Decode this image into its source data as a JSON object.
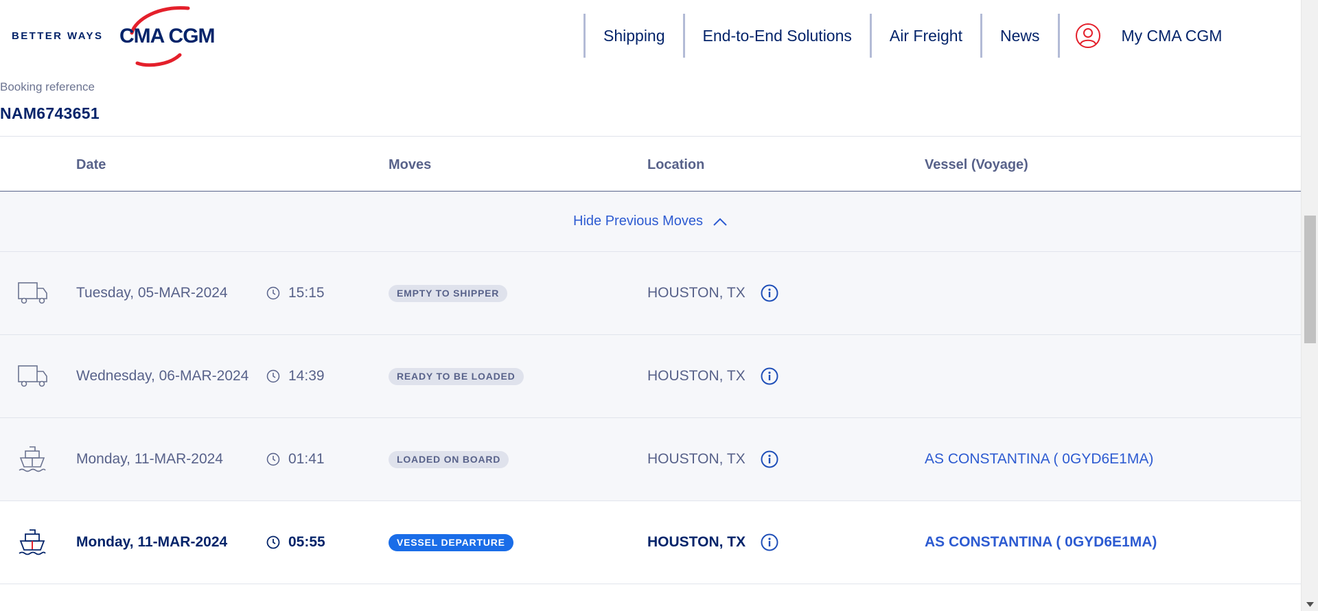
{
  "brand": {
    "tagline": "BETTER WAYS",
    "name": "CMA CGM",
    "accent_color": "#e4202b",
    "primary_color": "#04246a",
    "link_color": "#2d5bd1"
  },
  "nav": {
    "items": [
      "Shipping",
      "End-to-End Solutions",
      "Air Freight",
      "News"
    ],
    "account_label": "My CMA CGM",
    "account_icon": "user-circle-icon"
  },
  "booking": {
    "label": "Booking reference",
    "value": "NAM6743651"
  },
  "table": {
    "headers": {
      "date": "Date",
      "moves": "Moves",
      "location": "Location",
      "vessel": "Vessel (Voyage)"
    },
    "toggle_label": "Hide Previous Moves",
    "rows": [
      {
        "icon": "truck-icon",
        "date": "Tuesday, 05-MAR-2024",
        "time": "15:15",
        "move": "EMPTY TO SHIPPER",
        "location": "HOUSTON, TX",
        "vessel": ""
      },
      {
        "icon": "truck-icon",
        "date": "Wednesday, 06-MAR-2024",
        "time": "14:39",
        "move": "READY TO BE LOADED",
        "location": "HOUSTON, TX",
        "vessel": ""
      },
      {
        "icon": "ship-icon",
        "date": "Monday, 11-MAR-2024",
        "time": "01:41",
        "move": "LOADED ON BOARD",
        "location": "HOUSTON, TX",
        "vessel": "AS CONSTANTINA ( 0GYD6E1MA)"
      },
      {
        "icon": "ship-icon",
        "date": "Monday, 11-MAR-2024",
        "time": "05:55",
        "move": "VESSEL DEPARTURE",
        "location": "HOUSTON, TX",
        "vessel": "AS CONSTANTINA ( 0GYD6E1MA)"
      }
    ]
  }
}
